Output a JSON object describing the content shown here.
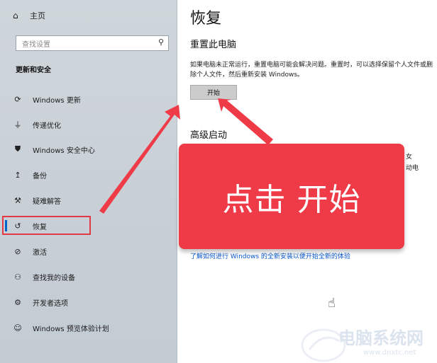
{
  "sidebar": {
    "home_label": "主页",
    "search_placeholder": "查找设置",
    "section_title": "更新和安全",
    "items": [
      {
        "icon": "refresh-icon",
        "label": "Windows 更新"
      },
      {
        "icon": "delivery-optimization-icon",
        "label": "传递优化"
      },
      {
        "icon": "shield-icon",
        "label": "Windows 安全中心"
      },
      {
        "icon": "backup-icon",
        "label": "备份"
      },
      {
        "icon": "wrench-icon",
        "label": "疑难解答"
      },
      {
        "icon": "recovery-icon",
        "label": "恢复"
      },
      {
        "icon": "activation-icon",
        "label": "激活"
      },
      {
        "icon": "find-device-icon",
        "label": "查找我的设备"
      },
      {
        "icon": "developer-icon",
        "label": "开发者选项"
      },
      {
        "icon": "insider-icon",
        "label": "Windows 预览体验计划"
      }
    ]
  },
  "main": {
    "title": "恢复",
    "reset_heading": "重置此电脑",
    "reset_description": "如果电脑未正常运行，重置电脑可能会解决问题。重置时，可以选择保留个人文件或删除个人文件，然后重新安装 Windows。",
    "start_button": "开始",
    "advanced_heading": "高级启动",
    "partial_text_1": "女",
    "partial_text_2": "动电",
    "learn_link": "了解如何进行 Windows 的全新安装以便开始全新的体验"
  },
  "annotation": {
    "callout_text": "点击 开始",
    "highlight_color": "#e23a44"
  },
  "watermark": {
    "text": "电脑系统网",
    "url": "www.dnxtc.net"
  }
}
